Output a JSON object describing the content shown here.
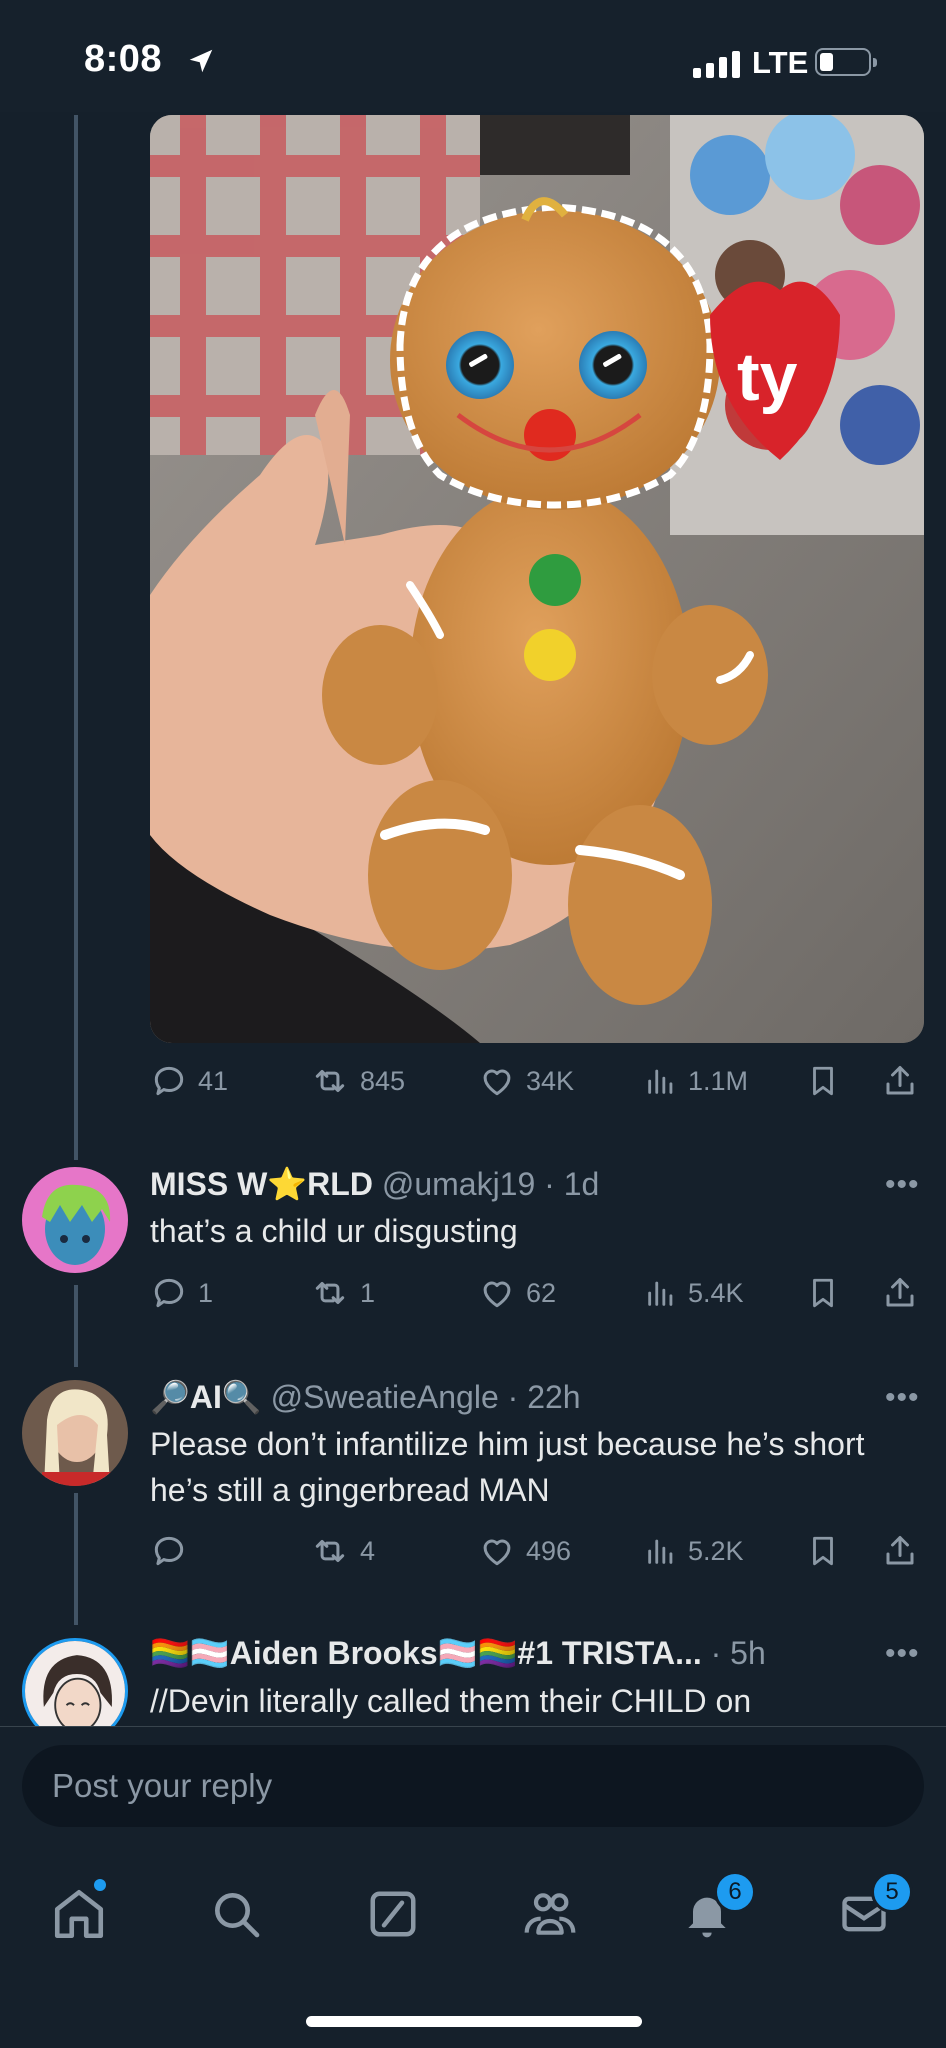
{
  "status_bar": {
    "time": "8:08",
    "network": "LTE"
  },
  "main_tweet": {
    "image_alt": "Ty Beanie Babies gingerbread man plush held in a hand",
    "stats": {
      "replies": "41",
      "reposts": "845",
      "likes": "34K",
      "views": "1.1M"
    }
  },
  "replies": [
    {
      "name": "MISS W⭐RLD",
      "handle_time": "@umakj19 · 1d",
      "text": "that’s a child ur disgusting",
      "stats": {
        "replies": "1",
        "reposts": "1",
        "likes": "62",
        "views": "5.4K"
      }
    },
    {
      "name": "🔎AI🔍",
      "handle_time": "@SweatieAngle · 22h",
      "text": "Please don’t infantilize him just because he’s short he’s still a gingerbread MAN",
      "stats": {
        "replies": "",
        "reposts": "4",
        "likes": "496",
        "views": "5.2K"
      }
    },
    {
      "name": "🏳️‍🌈🏳️‍⚧️Aiden Brooks🏳️‍⚧️🏳️‍🌈#1 TRISTA...",
      "handle_time": "· 5h",
      "text": "//Devin literally called them their CHILD on"
    }
  ],
  "more_label": "•••",
  "reply_box": {
    "placeholder": "Post your reply"
  },
  "tabbar": {
    "notifications_badge": "6",
    "messages_badge": "5"
  },
  "colors": {
    "accent": "#1d9bf0",
    "background": "#15202b",
    "muted": "#8b98a5"
  }
}
